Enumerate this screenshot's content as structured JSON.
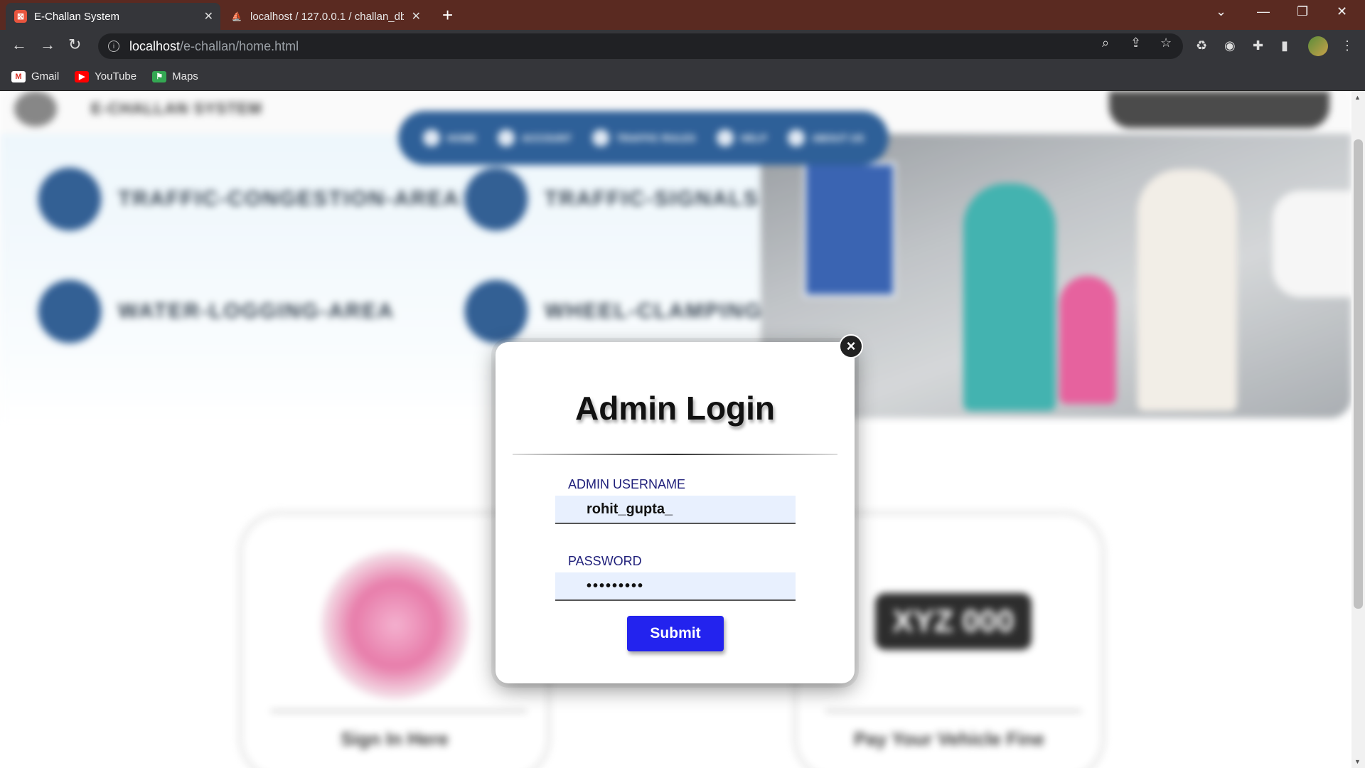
{
  "browser": {
    "tabs": [
      {
        "title": "E-Challan System",
        "active": true
      },
      {
        "title": "localhost / 127.0.0.1 / challan_db",
        "active": false
      }
    ],
    "url_host": "localhost",
    "url_path": "/e-challan/home.html",
    "bookmarks": [
      {
        "label": "Gmail",
        "icon": "gmail-icon"
      },
      {
        "label": "YouTube",
        "icon": "youtube-icon"
      },
      {
        "label": "Maps",
        "icon": "maps-icon"
      }
    ],
    "accent_color": "#5a2a21"
  },
  "page": {
    "card_plate_text": "XYZ 000"
  },
  "modal": {
    "title": "Admin Login",
    "username_label": "ADMIN USERNAME",
    "username_value": "rohit_gupta_",
    "password_label": "PASSWORD",
    "password_value": "•••••••••",
    "submit_label": "Submit",
    "close_glyph": "×",
    "submit_color": "#2323ee"
  }
}
